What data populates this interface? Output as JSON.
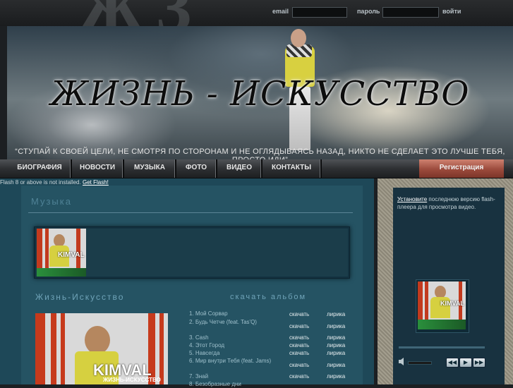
{
  "login": {
    "email_label": "email",
    "password_label": "пароль",
    "submit_label": "войти",
    "email_value": "",
    "password_value": ""
  },
  "banner": {
    "title": "ЖИЗНЬ - ИСКУССТВО",
    "quote": "“СТУПАЙ К СВОЕЙ ЦЕЛИ, НЕ СМОТРЯ ПО СТОРОНАМ И НЕ ОГЛЯДЫВАЯСЬ НАЗАД, НИКТО НЕ СДЕЛАЕТ ЭТО ЛУЧШЕ ТЕБЯ, ПРОСТО ИДИ”"
  },
  "nav": {
    "items": [
      "БИОГРАФИЯ",
      "НОВОСТИ",
      "МУЗЫКА",
      "ФОТО",
      "ВИДЕО",
      "КОНТАКТЫ"
    ],
    "register": "Регистрация"
  },
  "flash_notice": {
    "text": "Flash 8 or above is not installed.",
    "link": "Get Flash!"
  },
  "main": {
    "section_title": "Музыка",
    "album_title": "Жизнь-Искусство",
    "download_album": "скачать альбом",
    "cover_artist": "KIMVAL",
    "cover_album": "ЖИЗНЬ-ИСКУССТВО",
    "tracks": [
      {
        "name": "1. Мой Сорвар",
        "download": "скачать",
        "lyrics": "лирика"
      },
      {
        "name": "2. Будь Четче (feat. Tas'Q)",
        "download": "скачать",
        "lyrics": "лирика"
      },
      {
        "name": "3. Cash",
        "download": "скачать",
        "lyrics": "лирика"
      },
      {
        "name": "4. Этот Город",
        "download": "скачать",
        "lyrics": "лирика"
      },
      {
        "name": "5. Навсегда",
        "download": "скачать",
        "lyrics": "лирика"
      },
      {
        "name": "6. Мир внутри Тебя (feat. Jams)",
        "download": "скачать",
        "lyrics": "лирика"
      },
      {
        "name": "7. Знай",
        "download": "скачать",
        "lyrics": "лирика"
      },
      {
        "name": "8. Безобразные дни",
        "download": "",
        "lyrics": ""
      }
    ]
  },
  "sidebar": {
    "install_link": "Установите",
    "install_text": " последнюю версию flash-плеера для просмотра видео.",
    "cover_artist": "KIMVAL",
    "controls": {
      "prev": "◀◀",
      "play": "▶",
      "next": "▶▶"
    }
  }
}
